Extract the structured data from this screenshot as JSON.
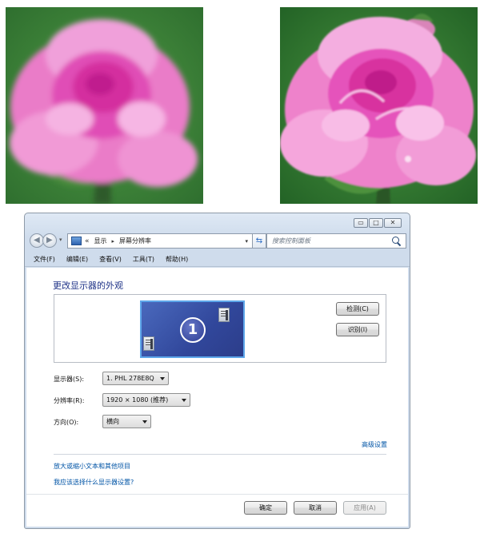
{
  "window": {
    "controls": [
      "minimize",
      "maximize",
      "close"
    ]
  },
  "address_bar": {
    "chevron": "«",
    "crumbs": [
      "显示",
      "屏幕分辨率"
    ],
    "separator": "▸",
    "search_placeholder": "搜索控制面板"
  },
  "menu": [
    "文件(F)",
    "编辑(E)",
    "查看(V)",
    "工具(T)",
    "帮助(H)"
  ],
  "content": {
    "heading": "更改显示器的外观",
    "monitor_number": "1",
    "detect_label": "检测(C)",
    "identify_label": "识别(I)",
    "fields": {
      "display_label": "显示器(S):",
      "display_value": "1. PHL 278E8Q",
      "resolution_label": "分辨率(R):",
      "resolution_value": "1920 × 1080 (推荐)",
      "orientation_label": "方向(O):",
      "orientation_value": "横向"
    },
    "advanced_link": "高级设置",
    "link_text_size": "放大或缩小文本和其他项目",
    "link_which_settings": "我应该选择什么显示器设置?"
  },
  "footer": {
    "ok_label": "确定",
    "cancel_label": "取消",
    "apply_label": "应用(A)"
  },
  "colors": {
    "heading": "#1e3287",
    "link": "#0054a6",
    "monitor_fill": "#3a54a8",
    "monitor_border": "#5da6ea",
    "rose_pink": "#e870c0",
    "leaf_green": "#3f8a3c"
  }
}
